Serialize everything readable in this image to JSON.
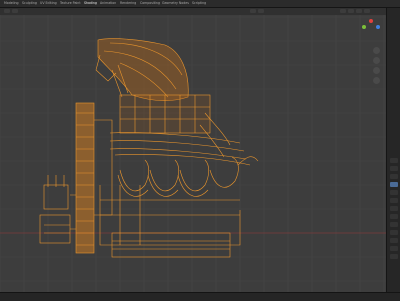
{
  "workspace_tabs": [
    {
      "label": "Modeling",
      "active": false
    },
    {
      "label": "Sculpting",
      "active": false
    },
    {
      "label": "UV Editing",
      "active": false
    },
    {
      "label": "Texture Paint",
      "active": false
    },
    {
      "label": "Shading",
      "active": true
    },
    {
      "label": "Animation",
      "active": false
    },
    {
      "label": "Rendering",
      "active": false
    },
    {
      "label": "Compositing",
      "active": false
    },
    {
      "label": "Geometry Nodes",
      "active": false
    },
    {
      "label": "Scripting",
      "active": false
    }
  ],
  "scene_name": "",
  "viewport": {
    "background": "#3d3d3d",
    "wire_color": "#f39a2c",
    "grid_color": "#474747"
  },
  "gizmo_colors": {
    "x": "#e2413d",
    "y": "#7cbf3a",
    "z": "#3f7fe0"
  },
  "status": {
    "text": ""
  },
  "icons": [
    "view-gizmo-icon",
    "zoom-icon",
    "pan-icon",
    "camera-icon",
    "grid-icon"
  ]
}
